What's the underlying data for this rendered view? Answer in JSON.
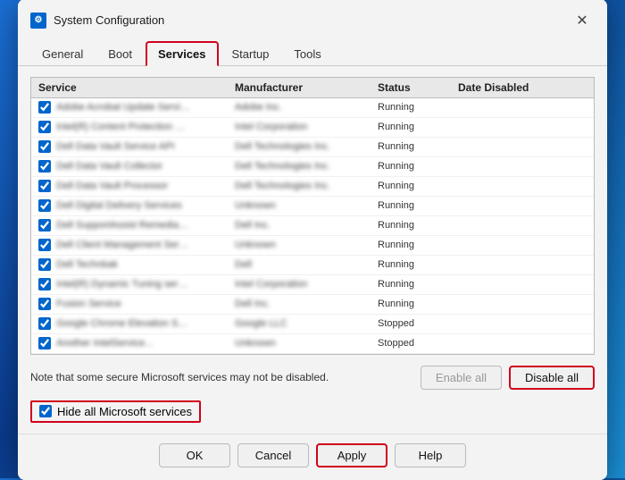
{
  "dialog": {
    "title": "System Configuration",
    "icon_label": "SC"
  },
  "tabs": [
    {
      "label": "General",
      "active": false
    },
    {
      "label": "Boot",
      "active": false
    },
    {
      "label": "Services",
      "active": true
    },
    {
      "label": "Startup",
      "active": false
    },
    {
      "label": "Tools",
      "active": false
    }
  ],
  "table": {
    "headers": [
      "Service",
      "Manufacturer",
      "Status",
      "Date Disabled"
    ],
    "rows": [
      {
        "checked": true,
        "service": "Adobe Acrobat Update Service",
        "manufacturer": "Adobe Inc.",
        "status": "Running",
        "date": ""
      },
      {
        "checked": true,
        "service": "Intel(R) Content Protection HSC...",
        "manufacturer": "Intel Corporation",
        "status": "Running",
        "date": ""
      },
      {
        "checked": true,
        "service": "Dell Data Vault Service API",
        "manufacturer": "Dell Technologies Inc.",
        "status": "Running",
        "date": ""
      },
      {
        "checked": true,
        "service": "Dell Data Vault Collector",
        "manufacturer": "Dell Technologies Inc.",
        "status": "Running",
        "date": ""
      },
      {
        "checked": true,
        "service": "Dell Data Vault Processor",
        "manufacturer": "Dell Technologies Inc.",
        "status": "Running",
        "date": ""
      },
      {
        "checked": true,
        "service": "Dell Digital Delivery Services",
        "manufacturer": "Unknown",
        "status": "Running",
        "date": ""
      },
      {
        "checked": true,
        "service": "Dell SupportAssist Remediation",
        "manufacturer": "Dell Inc.",
        "status": "Running",
        "date": ""
      },
      {
        "checked": true,
        "service": "Dell Client Management Service",
        "manufacturer": "Unknown",
        "status": "Running",
        "date": ""
      },
      {
        "checked": true,
        "service": "Dell Technbak",
        "manufacturer": "Dell",
        "status": "Running",
        "date": ""
      },
      {
        "checked": true,
        "service": "Intel(R) Dynamic Tuning service",
        "manufacturer": "Intel Corporation",
        "status": "Running",
        "date": ""
      },
      {
        "checked": true,
        "service": "Fusion Service",
        "manufacturer": "Dell Inc.",
        "status": "Running",
        "date": ""
      },
      {
        "checked": true,
        "service": "Google Chrome Elevation Servic...",
        "manufacturer": "Google LLC",
        "status": "Stopped",
        "date": ""
      },
      {
        "checked": true,
        "service": "Another Service...",
        "manufacturer": "Unknown",
        "status": "Stopped",
        "date": ""
      }
    ]
  },
  "note": "Note that some secure Microsoft services may not be disabled.",
  "buttons": {
    "enable_all": "Enable all",
    "disable_all": "Disable all",
    "hide_label": "Hide all Microsoft services",
    "ok": "OK",
    "cancel": "Cancel",
    "apply": "Apply",
    "help": "Help"
  }
}
